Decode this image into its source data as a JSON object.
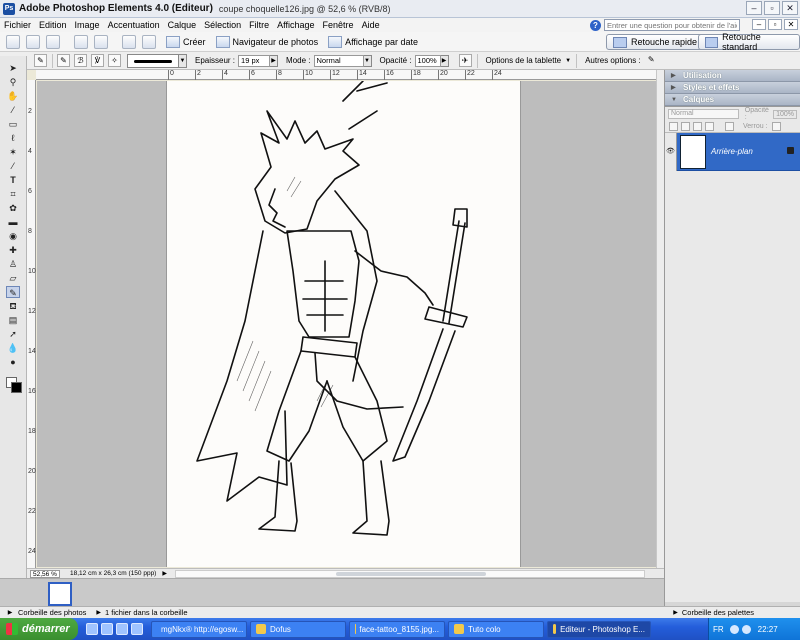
{
  "window": {
    "app_title": "Adobe Photoshop Elements 4.0 (Editeur)",
    "doc_title": "coupe choquelle126.jpg @ 52,6 % (RVB/8)"
  },
  "menu": [
    "Fichier",
    "Edition",
    "Image",
    "Accentuation",
    "Calque",
    "Sélection",
    "Filtre",
    "Affichage",
    "Fenêtre",
    "Aide"
  ],
  "help": {
    "placeholder": "Entrer une question pour obtenir de l'aide"
  },
  "shortcuts": {
    "create": "Créer",
    "photo_browser": "Navigateur de photos",
    "date_view": "Affichage par date",
    "quick_fix": "Retouche rapide",
    "standard_edit": "Retouche standard"
  },
  "options_bar": {
    "size_label": "Epaisseur :",
    "size_value": "19 px",
    "mode_label": "Mode :",
    "mode_value": "Normal",
    "opacity_label": "Opacité :",
    "opacity_value": "100%",
    "tablet_label": "Options de la tablette",
    "more_label": "Autres options :"
  },
  "ruler_top": [
    "0",
    "2",
    "4",
    "6",
    "8",
    "10",
    "12",
    "14",
    "16",
    "18",
    "20",
    "22",
    "24"
  ],
  "ruler_left": [
    "2",
    "4",
    "6",
    "8",
    "10",
    "12",
    "14",
    "16",
    "18",
    "20",
    "22",
    "24"
  ],
  "status": {
    "zoom": "52,56 %",
    "doc_info": "18,12 cm x 26,3 cm (150 ppp)"
  },
  "palettes": {
    "tabs": [
      "Utilisation",
      "Styles et effets",
      "Calques"
    ],
    "blend_mode": "Normal",
    "opacity_label": "Opacité :",
    "opacity_value": "100%",
    "lock_label": "Verrou :",
    "layer_name": "Arrière-plan"
  },
  "bin_bar": {
    "bin_label": "Corbeille des photos",
    "bin_count": "1 fichier dans la corbeille",
    "palette_bin_label": "Corbeille des palettes"
  },
  "taskbar": {
    "start": "démarrer",
    "tasks": [
      "mgNkx® http://egosw...",
      "Dofus",
      "face-tattoo_8155.jpg...",
      "Tuto colo",
      "Editeur - Photoshop E..."
    ],
    "lang": "FR",
    "clock": "22:27"
  }
}
